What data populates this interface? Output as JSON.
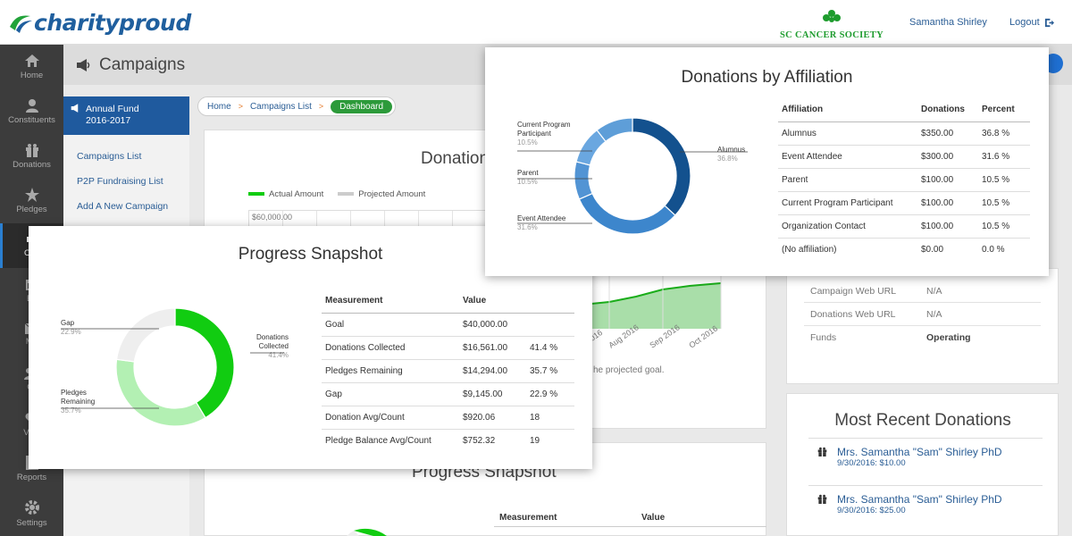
{
  "header": {
    "logo_text": "charityproud",
    "org_name": "SC CANCER SOCIETY",
    "user_name": "Samantha Shirley",
    "logout_label": "Logout"
  },
  "nav": [
    {
      "label": "Home",
      "icon": "home-icon"
    },
    {
      "label": "Constituents",
      "icon": "person-icon"
    },
    {
      "label": "Donations",
      "icon": "gift-icon"
    },
    {
      "label": "Pledges",
      "icon": "star-icon"
    },
    {
      "label": "Cam",
      "icon": "megaphone-icon"
    },
    {
      "label": "Ev",
      "icon": "calendar-icon"
    },
    {
      "label": "Ma",
      "icon": "mail-icon"
    },
    {
      "label": "Gr",
      "icon": "group-icon"
    },
    {
      "label": "Volu",
      "icon": "volunteer-icon"
    },
    {
      "label": "Reports",
      "icon": "report-icon"
    },
    {
      "label": "Settings",
      "icon": "gear-icon"
    }
  ],
  "page": {
    "title": "Campaigns"
  },
  "subnav": {
    "heading_line1": "Annual Fund",
    "heading_line2": "2016-2017",
    "links": [
      "Campaigns List",
      "P2P Fundraising List",
      "Add A New Campaign"
    ]
  },
  "breadcrumb": {
    "home": "Home",
    "list": "Campaigns List",
    "current": "Dashboard"
  },
  "background": {
    "donations_title": "Donation",
    "legend_actual": "Actual Amount",
    "legend_projected": "Projected Amount",
    "y_tick_top": "$60,000.00",
    "x_ticks": [
      "016",
      "Aug 2016",
      "Sep 2016",
      "Oct 2016"
    ],
    "note": "he projected goal.",
    "progress_title_bottom": "Progress Snapshot",
    "bottom_table_headers": [
      "Measurement",
      "Value"
    ],
    "info_rows": [
      {
        "label": "Campaign Web URL",
        "value": "N/A"
      },
      {
        "label": "Donations Web URL",
        "value": "N/A"
      },
      {
        "label": "Funds",
        "value": "Operating"
      }
    ],
    "recent_title": "Most Recent Donations",
    "recent_donations": [
      {
        "name": "Mrs. Samantha \"Sam\" Shirley PhD",
        "detail": "9/30/2016: $10.00"
      },
      {
        "name": "Mrs. Samantha \"Sam\" Shirley PhD",
        "detail": "9/30/2016: $25.00"
      }
    ]
  },
  "affiliation_card": {
    "title": "Donations by Affiliation",
    "headers": [
      "Affiliation",
      "Donations",
      "Percent"
    ],
    "rows": [
      [
        "Alumnus",
        "$350.00",
        "36.8 %"
      ],
      [
        "Event Attendee",
        "$300.00",
        "31.6 %"
      ],
      [
        "Parent",
        "$100.00",
        "10.5 %"
      ],
      [
        "Current Program Participant",
        "$100.00",
        "10.5 %"
      ],
      [
        "Organization Contact",
        "$100.00",
        "10.5 %"
      ],
      [
        "(No affiliation)",
        "$0.00",
        "0.0 %"
      ]
    ],
    "donut_labels": [
      {
        "name": "Alumnus",
        "pct": "36.8%"
      },
      {
        "name": "Current Program Participant",
        "pct": "10.5%"
      },
      {
        "name": "Parent",
        "pct": "10.5%"
      },
      {
        "name": "Event Attendee",
        "pct": "31.6%"
      }
    ]
  },
  "progress_card": {
    "title": "Progress Snapshot",
    "headers": [
      "Measurement",
      "Value"
    ],
    "rows": [
      [
        "Goal",
        "$40,000.00",
        ""
      ],
      [
        "Donations Collected",
        "$16,561.00",
        "41.4 %"
      ],
      [
        "Pledges Remaining",
        "$14,294.00",
        "35.7 %"
      ],
      [
        "Gap",
        "$9,145.00",
        "22.9 %"
      ],
      [
        "Donation Avg/Count",
        "$920.06",
        "18"
      ],
      [
        "Pledge Balance Avg/Count",
        "$752.32",
        "19"
      ]
    ],
    "donut_labels": [
      {
        "name": "Gap",
        "pct": "22.9%"
      },
      {
        "name": "Donations Collected",
        "pct": "41.4%"
      },
      {
        "name": "Pledges Remaining",
        "pct": "35.7%"
      }
    ]
  },
  "chart_data": [
    {
      "type": "pie",
      "title": "Donations by Affiliation",
      "categories": [
        "Alumnus",
        "Event Attendee",
        "Parent",
        "Current Program Participant",
        "Organization Contact",
        "(No affiliation)"
      ],
      "values": [
        36.8,
        31.6,
        10.5,
        10.5,
        10.5,
        0.0
      ],
      "colors": [
        "#13518e",
        "#3d86cc",
        "#5294d4",
        "#6aa7e0",
        "#5e9ed8",
        "#cccccc"
      ]
    },
    {
      "type": "pie",
      "title": "Progress Snapshot",
      "categories": [
        "Donations Collected",
        "Pledges Remaining",
        "Gap"
      ],
      "values": [
        41.4,
        35.7,
        22.9
      ],
      "colors": [
        "#11cc11",
        "#b3f0b3",
        "#eeeeee"
      ]
    }
  ]
}
